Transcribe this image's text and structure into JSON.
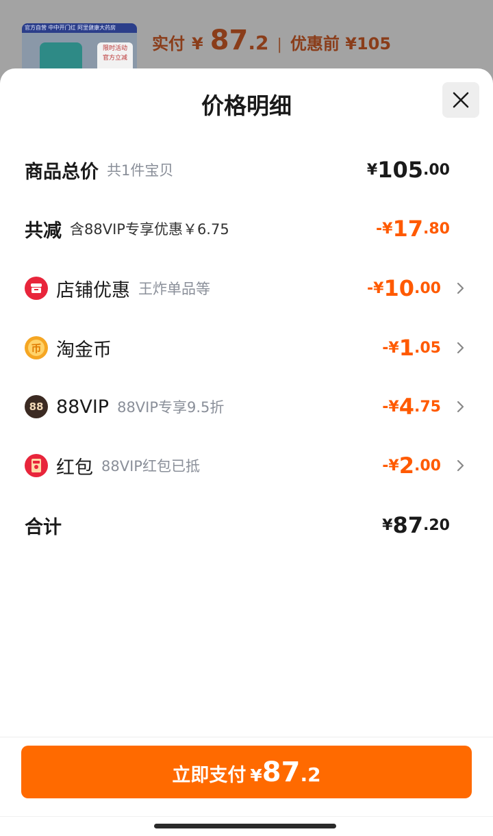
{
  "background": {
    "thumb_tag": "官方自营 中中开门红 阿里健康大药房",
    "thumb_badge_line1": "限时活动",
    "thumb_badge_line2": "官方立减",
    "price_label": "实付",
    "price_yuan": "¥",
    "price_int": "87",
    "price_dec": ".2",
    "separator": "|",
    "original_label": "优惠前 ¥105"
  },
  "sheet": {
    "title": "价格明细"
  },
  "rows": {
    "total": {
      "label": "商品总价",
      "sub": "共1件宝贝",
      "yuan": "¥",
      "int": "105",
      "dec": ".00"
    },
    "reduce": {
      "label": "共减",
      "sub": "含88VIP专享优惠￥6.75",
      "yuan": "-¥",
      "int": "17",
      "dec": ".80"
    },
    "store": {
      "label": "店铺优惠",
      "sub": "王炸单品等",
      "yuan": "-¥",
      "int": "10",
      "dec": ".00"
    },
    "coin": {
      "label": "淘金币",
      "sub": "",
      "yuan": "-¥",
      "int": "1",
      "dec": ".05"
    },
    "vip": {
      "label": "88VIP",
      "sub": "88VIP专享9.5折",
      "yuan": "-¥",
      "int": "4",
      "dec": ".75"
    },
    "redpacket": {
      "label": "红包",
      "sub": "88VIP红包已抵",
      "yuan": "-¥",
      "int": "2",
      "dec": ".00"
    },
    "sum": {
      "label": "合计",
      "yuan": "¥",
      "int": "87",
      "dec": ".20"
    }
  },
  "icons": {
    "store": "store-icon",
    "coin": "coin-icon",
    "vip": "vip88-icon",
    "vip_text": "88",
    "redpacket": "red-packet-icon",
    "coin_text": "币"
  },
  "pay": {
    "label": "立即支付",
    "yuan": "¥",
    "int": "87",
    "dec": ".2"
  },
  "colors": {
    "accent": "#ff6a00",
    "discount": "#ff5a00",
    "store_icon": "#e8253b",
    "coin_icon": "#f5a623",
    "vip_icon": "#3b2a22"
  }
}
